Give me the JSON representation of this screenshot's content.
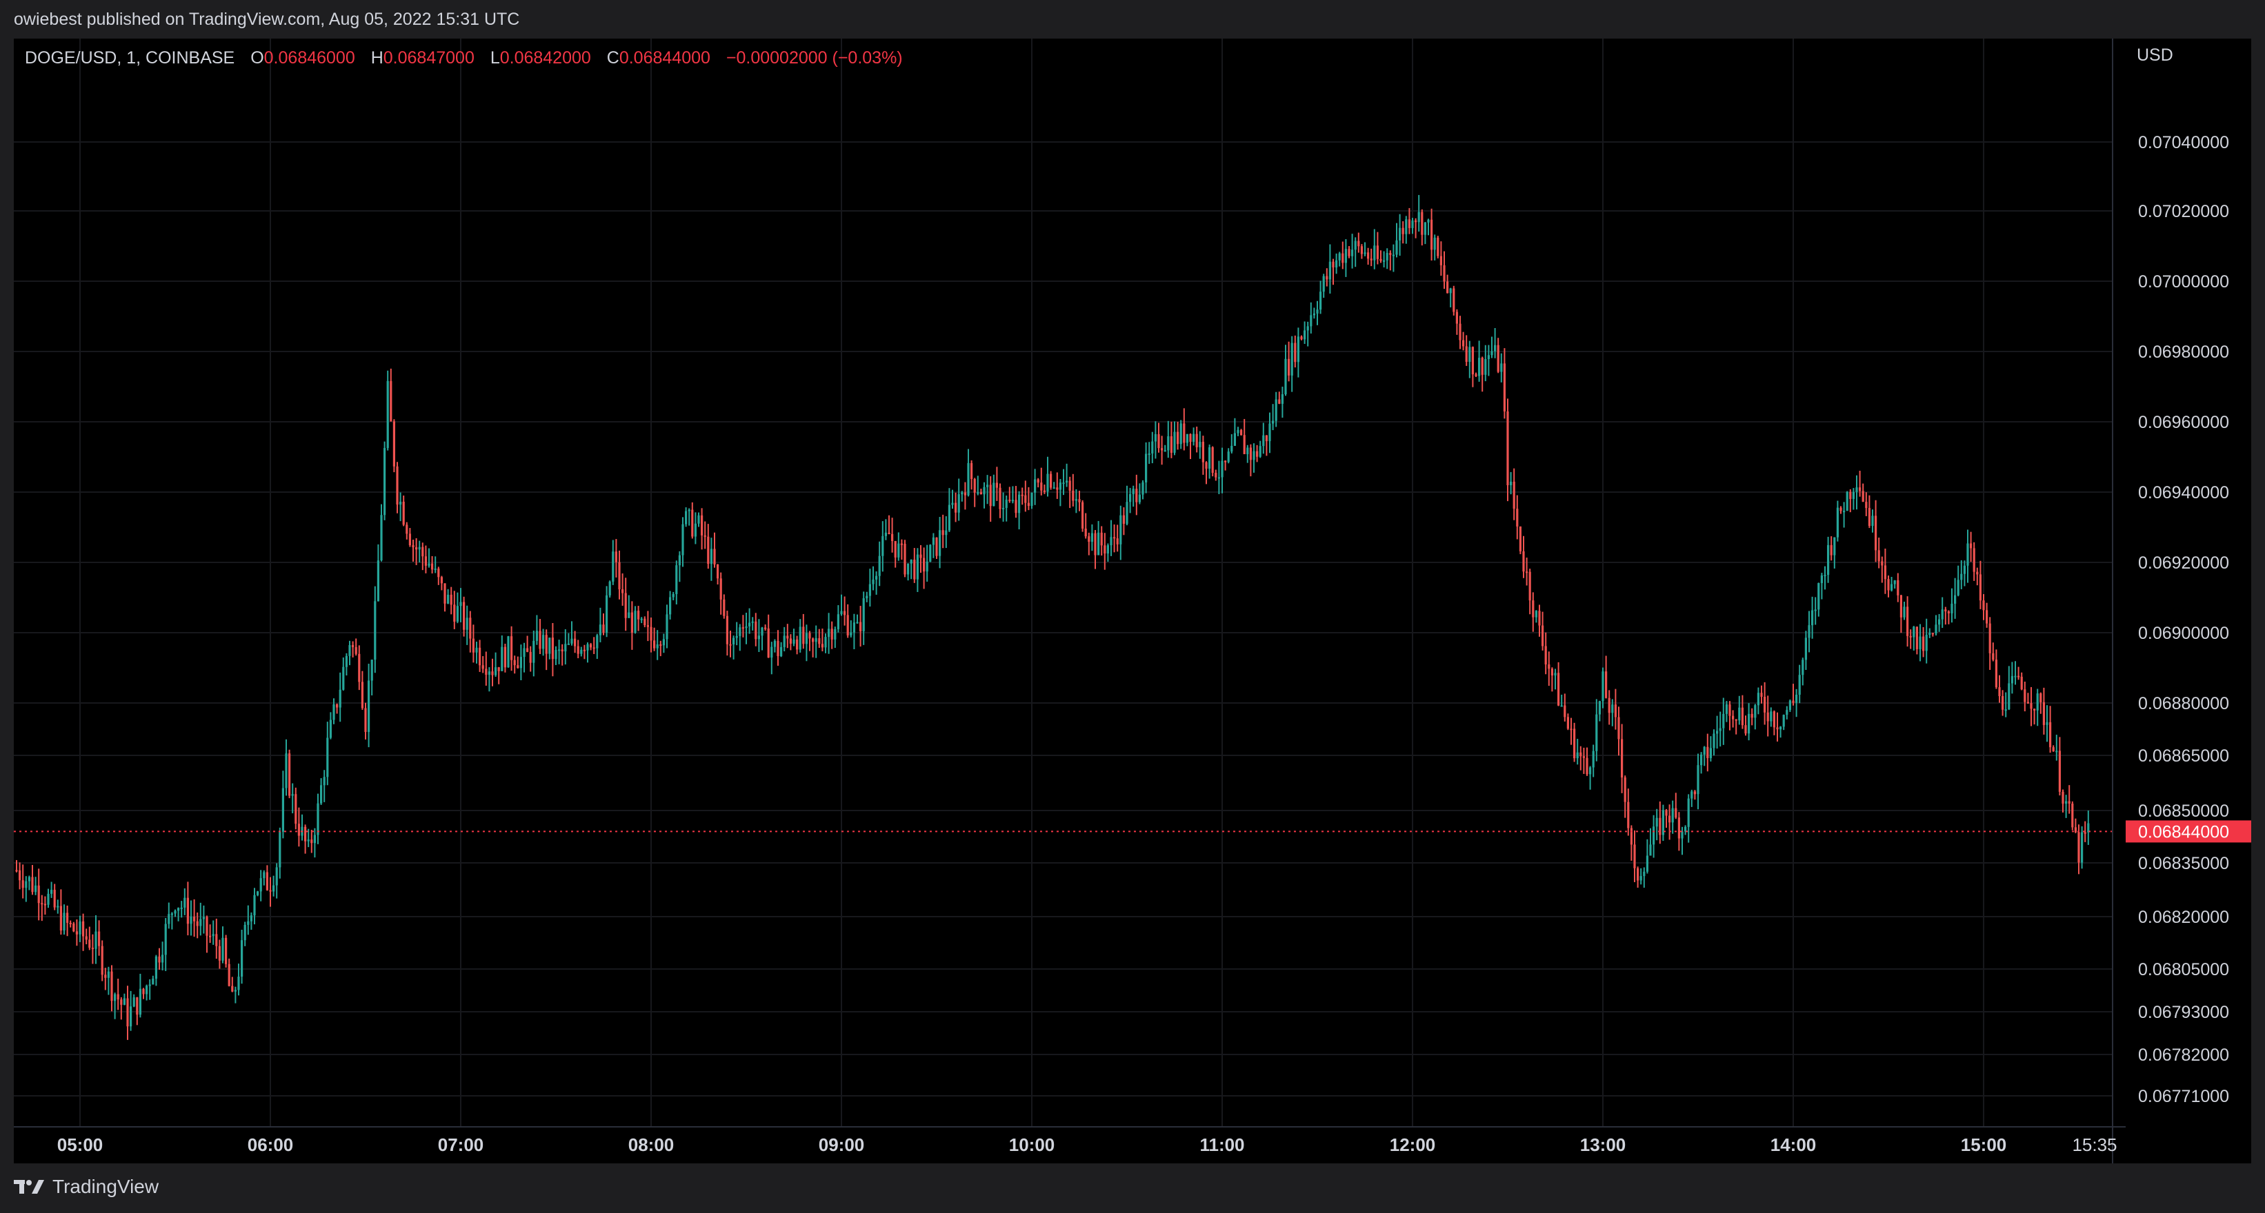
{
  "header": {
    "published": "owiebest published on TradingView.com, Aug 05, 2022 15:31 UTC"
  },
  "legend": {
    "symbol": "DOGE/USD, 1, COINBASE",
    "open_label": "O",
    "open": "0.06846000",
    "high_label": "H",
    "high": "0.06847000",
    "low_label": "L",
    "low": "0.06842000",
    "close_label": "C",
    "close": "0.06844000",
    "change": "−0.00002000 (−0.03%)"
  },
  "currency": "USD",
  "branding": "TradingView",
  "colors": {
    "up": "#26a69a",
    "down": "#ef5350",
    "background": "#000000",
    "last_price": "#f23645"
  },
  "chart_data": {
    "type": "candlestick",
    "symbol": "DOGE/USD",
    "interval": "1",
    "exchange": "COINBASE",
    "y_tick_labels": [
      "0.07040000",
      "0.07020000",
      "0.07000000",
      "0.06980000",
      "0.06960000",
      "0.06940000",
      "0.06920000",
      "0.06900000",
      "0.06880000",
      "0.06865000",
      "0.06850000",
      "0.06835000",
      "0.06820000",
      "0.06805000",
      "0.06793000",
      "0.06782000",
      "0.06771000"
    ],
    "x_tick_labels": [
      "05:00",
      "06:00",
      "07:00",
      "08:00",
      "09:00",
      "10:00",
      "11:00",
      "12:00",
      "13:00",
      "14:00",
      "15:00"
    ],
    "x_end_label": "15:35",
    "last_price": "0.06844000",
    "price_path": [
      [
        "04:40",
        0.06833
      ],
      [
        "04:50",
        0.06825
      ],
      [
        "04:55",
        0.06818
      ],
      [
        "05:05",
        0.06812
      ],
      [
        "05:10",
        0.068
      ],
      [
        "05:15",
        0.06792
      ],
      [
        "05:20",
        0.06798
      ],
      [
        "05:25",
        0.0681
      ],
      [
        "05:30",
        0.06825
      ],
      [
        "05:35",
        0.0682
      ],
      [
        "05:40",
        0.06815
      ],
      [
        "05:45",
        0.0681
      ],
      [
        "05:48",
        0.06795
      ],
      [
        "05:52",
        0.06815
      ],
      [
        "05:55",
        0.06828
      ],
      [
        "06:00",
        0.0683
      ],
      [
        "06:02",
        0.06835
      ],
      [
        "06:05",
        0.06862
      ],
      [
        "06:08",
        0.06848
      ],
      [
        "06:12",
        0.06838
      ],
      [
        "06:15",
        0.0685
      ],
      [
        "06:18",
        0.06868
      ],
      [
        "06:22",
        0.06885
      ],
      [
        "06:25",
        0.06898
      ],
      [
        "06:28",
        0.0689
      ],
      [
        "06:30",
        0.06875
      ],
      [
        "06:33",
        0.06905
      ],
      [
        "06:35",
        0.06935
      ],
      [
        "06:37",
        0.06968
      ],
      [
        "06:40",
        0.0694
      ],
      [
        "06:45",
        0.06925
      ],
      [
        "06:50",
        0.0692
      ],
      [
        "06:55",
        0.0691
      ],
      [
        "07:00",
        0.06905
      ],
      [
        "07:05",
        0.06895
      ],
      [
        "07:10",
        0.0689
      ],
      [
        "07:15",
        0.06895
      ],
      [
        "07:20",
        0.06892
      ],
      [
        "07:25",
        0.06898
      ],
      [
        "07:30",
        0.06893
      ],
      [
        "07:35",
        0.06896
      ],
      [
        "07:40",
        0.06898
      ],
      [
        "07:45",
        0.069
      ],
      [
        "07:48",
        0.06922
      ],
      [
        "07:52",
        0.06905
      ],
      [
        "08:00",
        0.06898
      ],
      [
        "08:05",
        0.06902
      ],
      [
        "08:10",
        0.06932
      ],
      [
        "08:15",
        0.0693
      ],
      [
        "08:20",
        0.06918
      ],
      [
        "08:25",
        0.06895
      ],
      [
        "08:30",
        0.06905
      ],
      [
        "08:35",
        0.06898
      ],
      [
        "08:40",
        0.06895
      ],
      [
        "08:45",
        0.069
      ],
      [
        "08:50",
        0.06895
      ],
      [
        "08:55",
        0.069
      ],
      [
        "09:00",
        0.06905
      ],
      [
        "09:05",
        0.069
      ],
      [
        "09:10",
        0.06918
      ],
      [
        "09:15",
        0.06928
      ],
      [
        "09:20",
        0.0692
      ],
      [
        "09:25",
        0.06918
      ],
      [
        "09:30",
        0.06925
      ],
      [
        "09:35",
        0.06935
      ],
      [
        "09:40",
        0.06945
      ],
      [
        "09:45",
        0.0694
      ],
      [
        "09:50",
        0.06938
      ],
      [
        "09:55",
        0.06935
      ],
      [
        "10:00",
        0.0694
      ],
      [
        "10:05",
        0.06945
      ],
      [
        "10:10",
        0.06942
      ],
      [
        "10:15",
        0.06935
      ],
      [
        "10:20",
        0.06925
      ],
      [
        "10:25",
        0.06925
      ],
      [
        "10:30",
        0.06935
      ],
      [
        "10:35",
        0.06945
      ],
      [
        "10:40",
        0.06955
      ],
      [
        "10:45",
        0.06955
      ],
      [
        "10:50",
        0.06958
      ],
      [
        "10:55",
        0.0695
      ],
      [
        "11:00",
        0.06945
      ],
      [
        "11:05",
        0.06955
      ],
      [
        "11:10",
        0.0695
      ],
      [
        "11:15",
        0.06958
      ],
      [
        "11:20",
        0.06975
      ],
      [
        "11:25",
        0.06985
      ],
      [
        "11:30",
        0.06995
      ],
      [
        "11:35",
        0.07005
      ],
      [
        "11:40",
        0.0701
      ],
      [
        "11:45",
        0.07008
      ],
      [
        "11:50",
        0.07005
      ],
      [
        "11:55",
        0.07012
      ],
      [
        "12:00",
        0.0702
      ],
      [
        "12:05",
        0.07015
      ],
      [
        "12:10",
        0.07
      ],
      [
        "12:15",
        0.06985
      ],
      [
        "12:20",
        0.06975
      ],
      [
        "12:25",
        0.0698
      ],
      [
        "12:28",
        0.06975
      ],
      [
        "12:30",
        0.06945
      ],
      [
        "12:35",
        0.0692
      ],
      [
        "12:40",
        0.069
      ],
      [
        "12:45",
        0.06885
      ],
      [
        "12:50",
        0.0687
      ],
      [
        "12:55",
        0.0686
      ],
      [
        "13:00",
        0.06885
      ],
      [
        "13:05",
        0.0687
      ],
      [
        "13:10",
        0.0683
      ],
      [
        "13:15",
        0.0684
      ],
      [
        "13:20",
        0.0685
      ],
      [
        "13:25",
        0.06845
      ],
      [
        "13:30",
        0.0686
      ],
      [
        "13:35",
        0.0687
      ],
      [
        "13:40",
        0.0688
      ],
      [
        "13:45",
        0.06875
      ],
      [
        "13:50",
        0.0688
      ],
      [
        "13:55",
        0.06875
      ],
      [
        "14:00",
        0.0688
      ],
      [
        "14:05",
        0.069
      ],
      [
        "14:10",
        0.0692
      ],
      [
        "14:15",
        0.06935
      ],
      [
        "14:20",
        0.06945
      ],
      [
        "14:25",
        0.0693
      ],
      [
        "14:30",
        0.06915
      ],
      [
        "14:35",
        0.06905
      ],
      [
        "14:40",
        0.06895
      ],
      [
        "14:45",
        0.069
      ],
      [
        "14:50",
        0.0691
      ],
      [
        "14:55",
        0.06925
      ],
      [
        "15:00",
        0.06905
      ],
      [
        "15:05",
        0.0688
      ],
      [
        "15:10",
        0.06885
      ],
      [
        "15:15",
        0.06882
      ],
      [
        "15:20",
        0.06875
      ],
      [
        "15:25",
        0.06855
      ],
      [
        "15:30",
        0.06838
      ],
      [
        "15:33",
        0.06844
      ]
    ]
  }
}
